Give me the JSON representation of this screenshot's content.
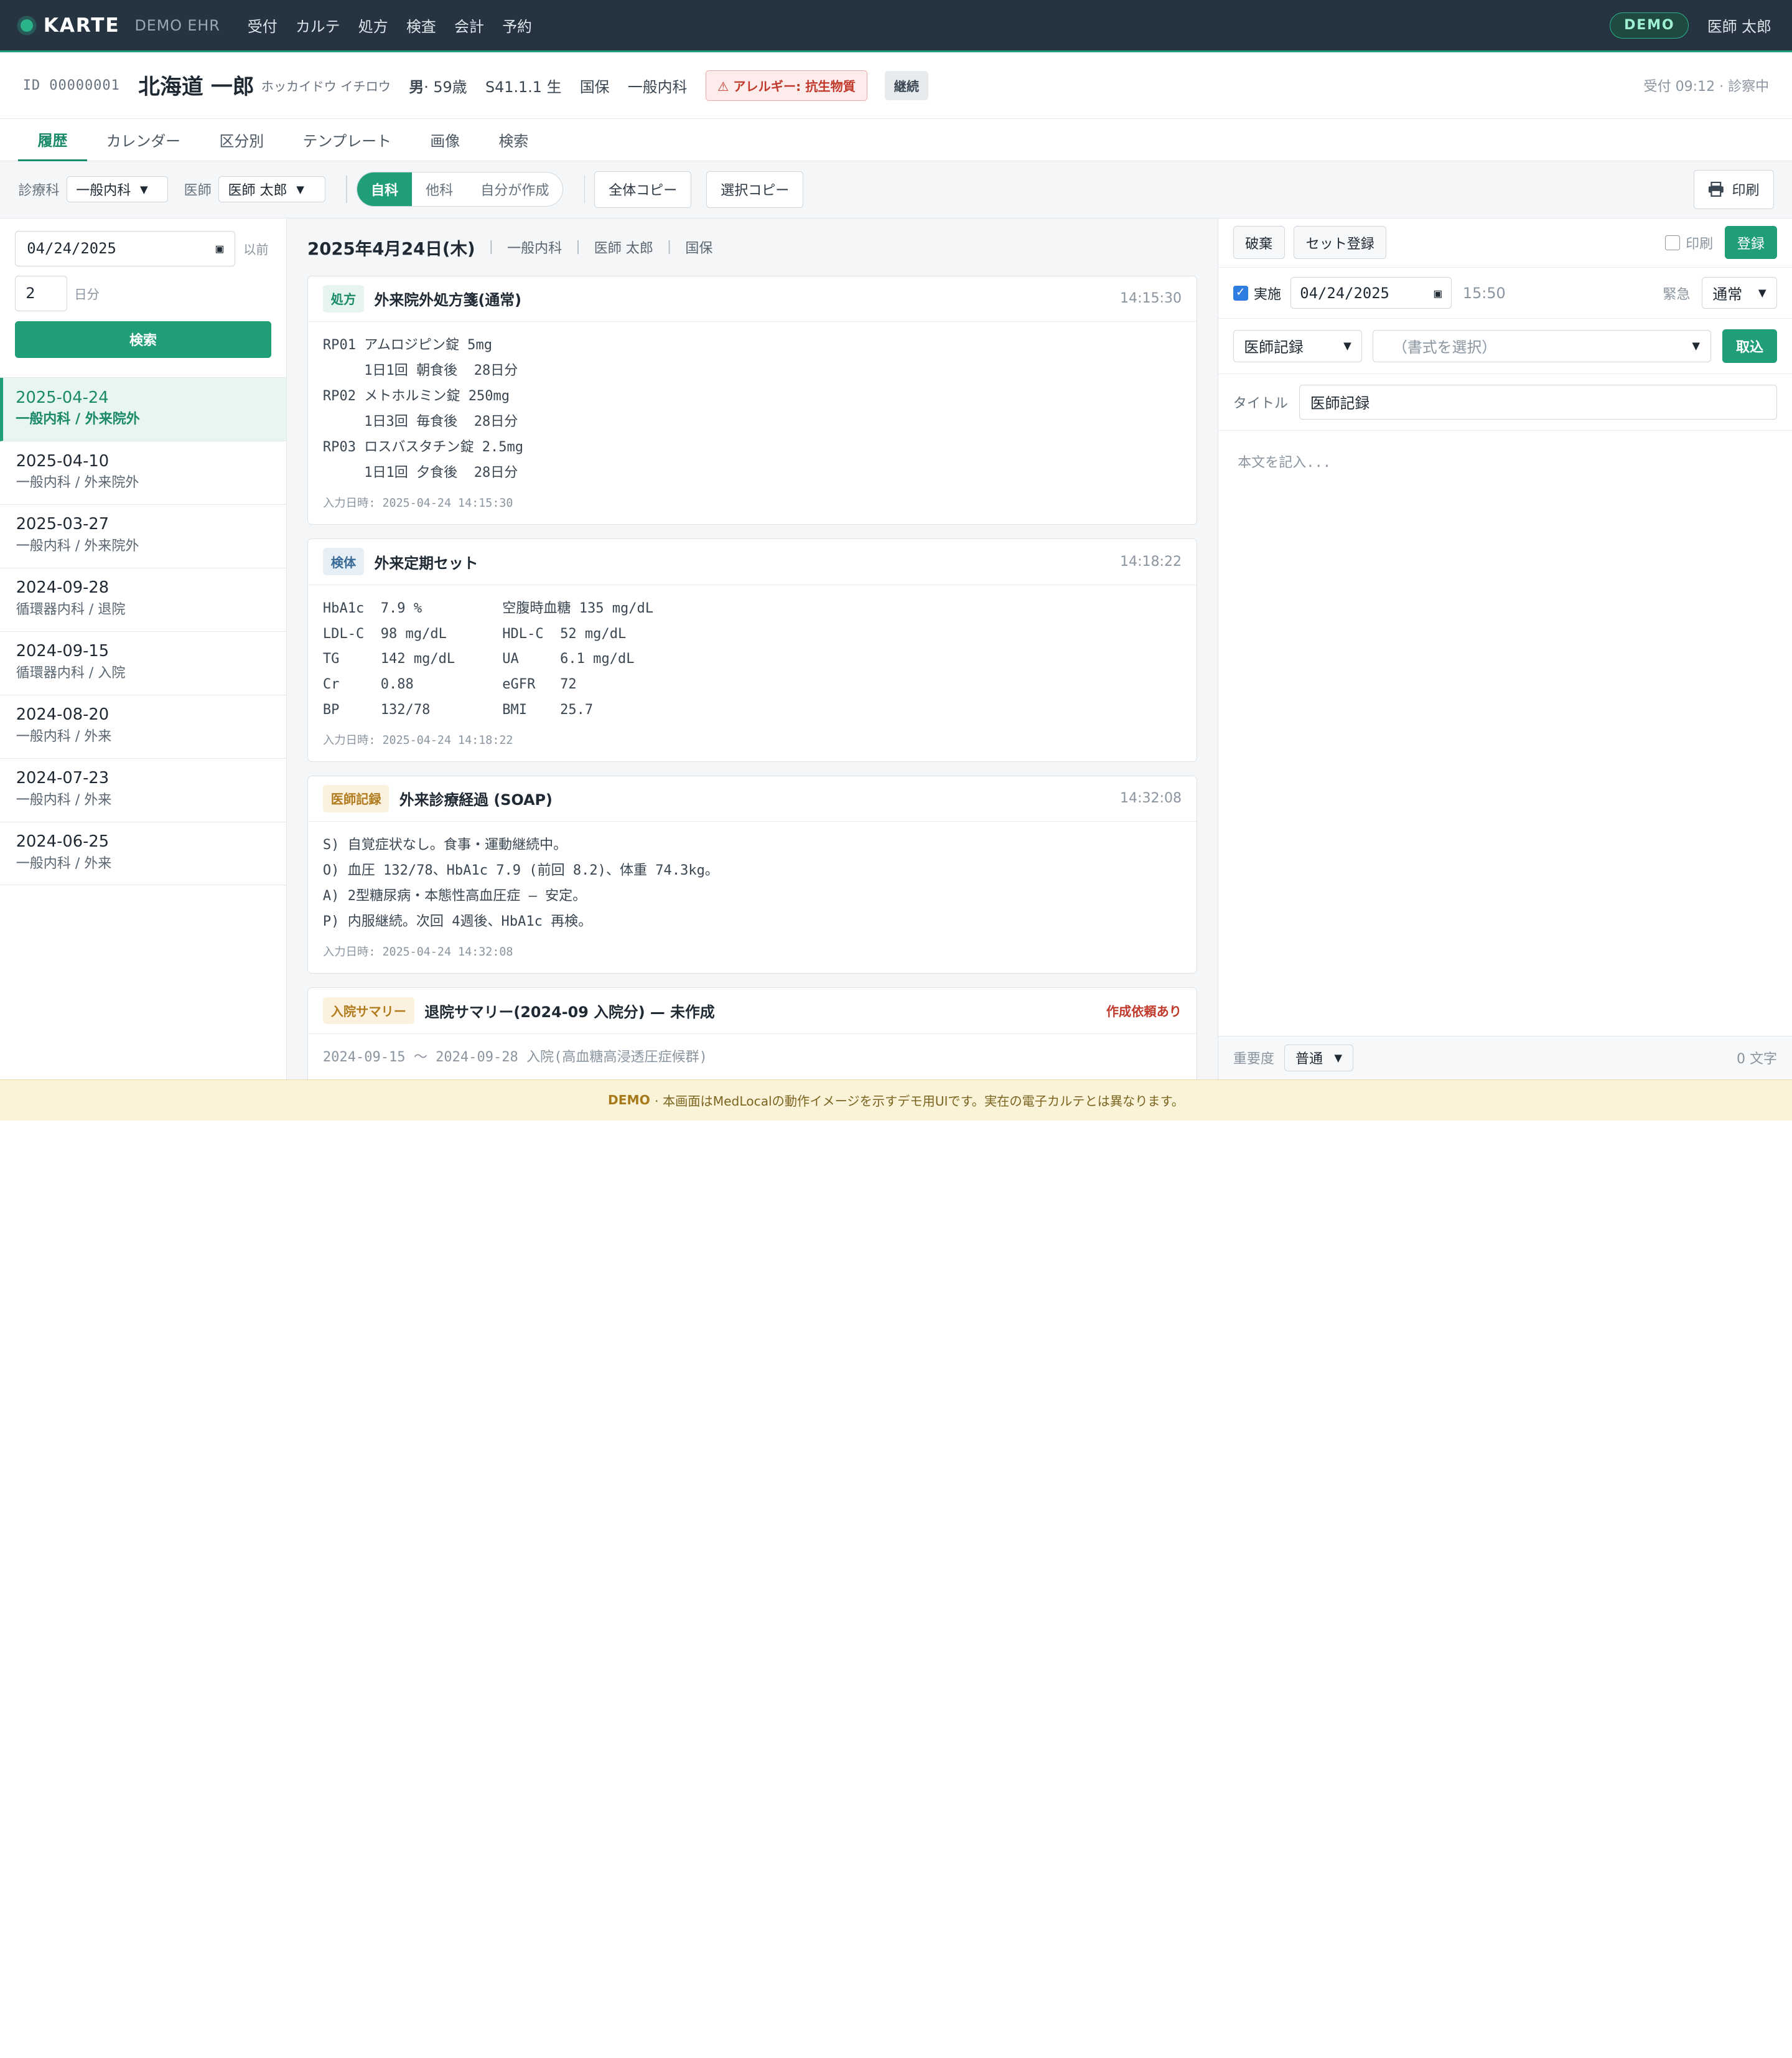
{
  "topbar": {
    "brand": "KARTE",
    "brand_sub": "DEMO EHR",
    "nav": [
      "受付",
      "カルテ",
      "処方",
      "検査",
      "会計",
      "予約"
    ],
    "demo_badge": "DEMO",
    "user": "医師 太郎"
  },
  "patient": {
    "id": "ID 00000001",
    "name": "北海道 一郎",
    "kana": "ホッカイドウ イチロウ",
    "sex": "男",
    "age": "· 59歳",
    "dob": "S41.1.1 生",
    "insurance": "国保",
    "department": "一般内科",
    "allergy": "⚠ アレルギー: 抗生物質",
    "continuing": "継続",
    "status": "受付 09:12 · 診察中"
  },
  "tabs": [
    "履歴",
    "カレンダー",
    "区分別",
    "テンプレート",
    "画像",
    "検索"
  ],
  "toolbar": {
    "dept_label": "診療科",
    "dept_value": "一般内科",
    "doctor_label": "医師",
    "doctor_value": "医師 太郎",
    "segments": [
      "自科",
      "他科",
      "自分が作成"
    ],
    "copy_all": "全体コピー",
    "copy_selected": "選択コピー",
    "print": "印刷"
  },
  "history_filter": {
    "date": "04/24/2025",
    "before_label": "以前",
    "count": "2",
    "count_unit": "日分",
    "search": "検索"
  },
  "visits": [
    {
      "date": "2025-04-24",
      "sub": "一般内科 / 外来院外"
    },
    {
      "date": "2025-04-10",
      "sub": "一般内科 / 外来院外"
    },
    {
      "date": "2025-03-27",
      "sub": "一般内科 / 外来院外"
    },
    {
      "date": "2024-09-28",
      "sub": "循環器内科 / 退院"
    },
    {
      "date": "2024-09-15",
      "sub": "循環器内科 / 入院"
    },
    {
      "date": "2024-08-20",
      "sub": "一般内科 / 外来"
    },
    {
      "date": "2024-07-23",
      "sub": "一般内科 / 外来"
    },
    {
      "date": "2024-06-25",
      "sub": "一般内科 / 外来"
    }
  ],
  "day": {
    "date": "2025年4月24日(木)",
    "meta": [
      "一般内科",
      "医師 太郎",
      "国保"
    ]
  },
  "cards": {
    "rx": {
      "tag": "処方",
      "title": "外来院外処方箋(通常)",
      "time": "14:15:30",
      "lines": [
        "RP01 アムロジピン錠 5mg",
        "     1日1回 朝食後  28日分",
        "RP02 メトホルミン錠 250mg",
        "     1日3回 毎食後  28日分",
        "RP03 ロスバスタチン錠 2.5mg",
        "     1日1回 夕食後  28日分"
      ],
      "stamp": "入力日時: 2025-04-24 14:15:30"
    },
    "lab": {
      "tag": "検体",
      "title": "外来定期セット",
      "time": "14:18:22",
      "items": [
        "HbA1c  7.9 %",
        "空腹時血糖 135 mg/dL",
        "LDL-C  98 mg/dL",
        "HDL-C  52 mg/dL",
        "TG     142 mg/dL",
        "UA     6.1 mg/dL",
        "Cr     0.88",
        "eGFR   72",
        "BP     132/78",
        "BMI    25.7"
      ],
      "stamp": "入力日時: 2025-04-24 14:18:22"
    },
    "soap": {
      "tag": "医師記録",
      "title": "外来診療経過 (SOAP)",
      "time": "14:32:08",
      "lines": [
        "S) 自覚症状なし。食事・運動継続中。",
        "O) 血圧 132/78、HbA1c 7.9 (前回 8.2)、体重 74.3kg。",
        "A) 2型糖尿病・本態性高血圧症 — 安定。",
        "P) 内服継続。次回 4週後、HbA1c 再検。"
      ],
      "stamp": "入力日時: 2025-04-24 14:32:08"
    },
    "summary": {
      "tag": "入院サマリー",
      "title": "退院サマリー(2024-09 入院分) — 未作成",
      "alert": "作成依頼あり",
      "line": "2024-09-15 〜 2024-09-28 入院(高血糖高浸透圧症候群)"
    }
  },
  "editor": {
    "discard": "破棄",
    "set_register": "セット登録",
    "print_label": "印刷",
    "register": "登録",
    "done_label": "実施",
    "date": "04/24/2025",
    "time": "15:50",
    "urgency_label": "緊急",
    "urgency_value": "通常",
    "record_type": "医師記録",
    "template_placeholder": "（書式を選択）",
    "import": "取込",
    "title_label": "タイトル",
    "title_value": "医師記録",
    "body_placeholder": "本文を記入...",
    "importance_label": "重要度",
    "importance_value": "普通",
    "char_count": "0 文字"
  },
  "footer": {
    "badge": "DEMO",
    "text": "· 本画面はMedLocalの動作イメージを示すデモ用UIです。実在の電子カルテとは異なります。"
  }
}
